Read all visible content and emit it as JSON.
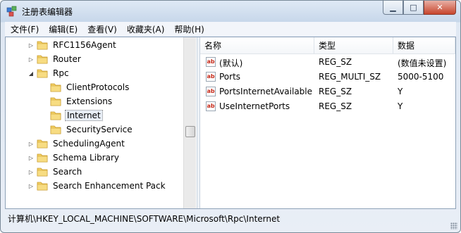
{
  "window": {
    "title": "注册表编辑器"
  },
  "menu": {
    "items": [
      "文件(F)",
      "编辑(E)",
      "查看(V)",
      "收藏夹(A)",
      "帮助(H)"
    ]
  },
  "tree": {
    "items": [
      {
        "label": "RFC1156Agent",
        "depth": 1,
        "expander": "collapsed"
      },
      {
        "label": "Router",
        "depth": 1,
        "expander": "collapsed"
      },
      {
        "label": "Rpc",
        "depth": 1,
        "expander": "expanded"
      },
      {
        "label": "ClientProtocols",
        "depth": 2,
        "expander": "none"
      },
      {
        "label": "Extensions",
        "depth": 2,
        "expander": "none"
      },
      {
        "label": "Internet",
        "depth": 2,
        "expander": "none",
        "selected": true
      },
      {
        "label": "SecurityService",
        "depth": 2,
        "expander": "none"
      },
      {
        "label": "SchedulingAgent",
        "depth": 1,
        "expander": "collapsed"
      },
      {
        "label": "Schema Library",
        "depth": 1,
        "expander": "collapsed"
      },
      {
        "label": "Search",
        "depth": 1,
        "expander": "collapsed"
      },
      {
        "label": "Search Enhancement Pack",
        "depth": 1,
        "expander": "collapsed"
      }
    ]
  },
  "list": {
    "columns": [
      "名称",
      "类型",
      "数据"
    ],
    "rows": [
      {
        "name": "(默认)",
        "type": "REG_SZ",
        "data": "(数值未设置)",
        "icon": "ab-string-icon"
      },
      {
        "name": "Ports",
        "type": "REG_MULTI_SZ",
        "data": "5000-5100",
        "icon": "ab-string-icon"
      },
      {
        "name": "PortsInternetAvailable",
        "type": "REG_SZ",
        "data": "Y",
        "icon": "ab-string-icon"
      },
      {
        "name": "UseInternetPorts",
        "type": "REG_SZ",
        "data": "Y",
        "icon": "ab-string-icon"
      }
    ]
  },
  "status": {
    "path": "计算机\\HKEY_LOCAL_MACHINE\\SOFTWARE\\Microsoft\\Rpc\\Internet"
  },
  "colors": {
    "folder": "#f2cf62",
    "selection": "#e8eef6",
    "ab_text": "#c62a1a"
  }
}
